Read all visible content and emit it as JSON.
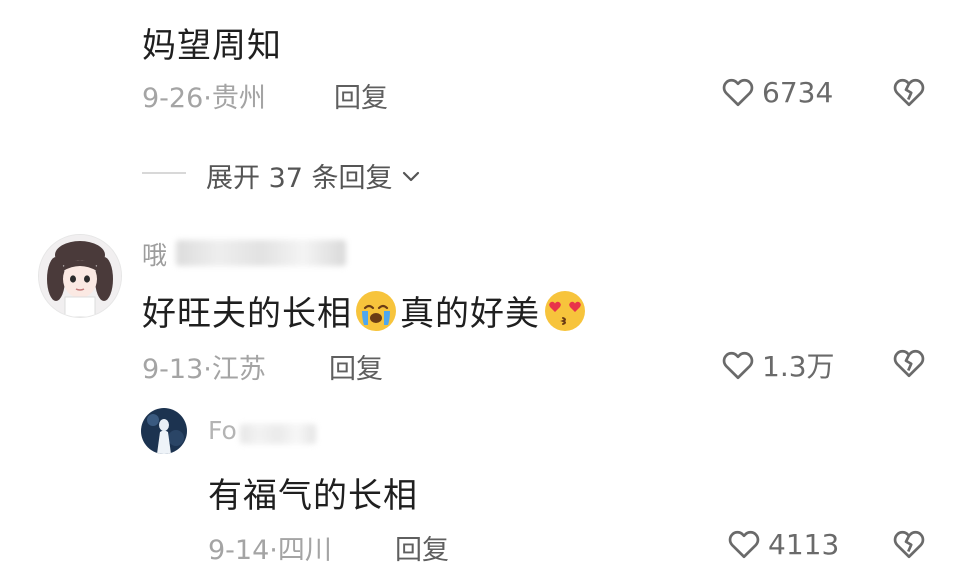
{
  "comment_top": {
    "text": "妈望周知",
    "date": "9-26",
    "location": "贵州",
    "reply_label": "回复",
    "likes": "6734"
  },
  "expand": {
    "label": "展开 37 条回复"
  },
  "comment_main": {
    "username_visible": "哦",
    "text_part1": "好旺夫的长相",
    "text_part2": "真的好美",
    "emoji1": "crying-face",
    "emoji2": "heart-eyes-kiss-face",
    "date": "9-13",
    "location": "江苏",
    "reply_label": "回复",
    "likes": "1.3万"
  },
  "reply": {
    "username_visible": "Fo",
    "text": "有福气的长相",
    "date": "9-14",
    "location": "四川",
    "reply_label": "回复",
    "likes": "4113"
  },
  "colors": {
    "meta_gray": "#a4a4a4",
    "text_dark": "#1f1f1f",
    "icon_gray": "#6a6a6a",
    "emoji_yellow": "#f7c43c",
    "avatar_reply_bg": "#1c3350"
  }
}
